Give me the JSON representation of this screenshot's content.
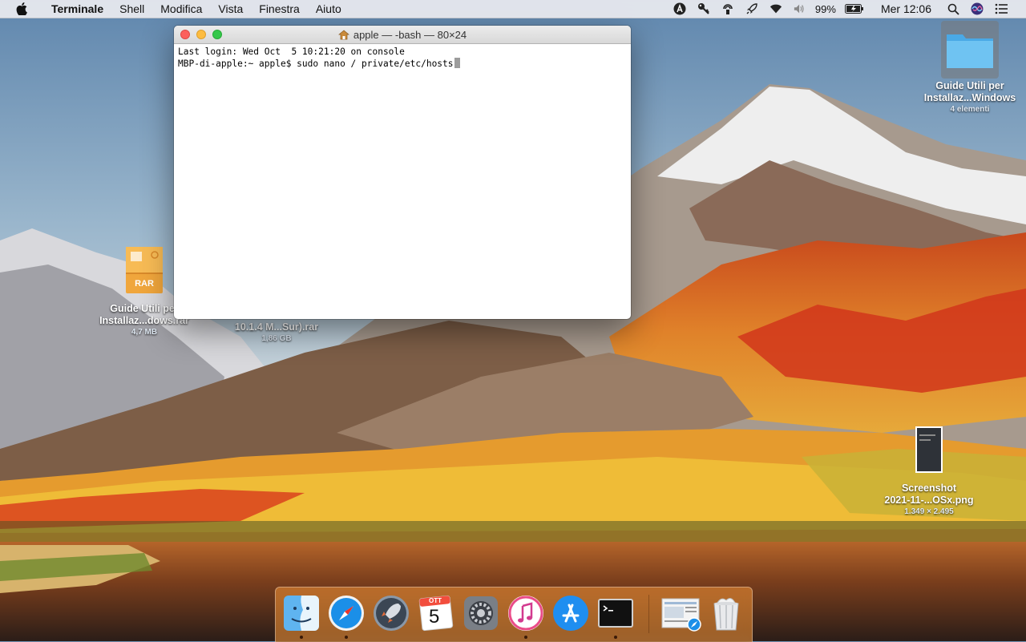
{
  "menubar": {
    "app_name": "Terminale",
    "items": [
      "Shell",
      "Modifica",
      "Vista",
      "Finestra",
      "Aiuto"
    ],
    "battery": "99%",
    "clock": "Mer 12:06"
  },
  "terminal": {
    "title": "apple — -bash — 80×24",
    "lines": [
      "Last login: Wed Oct  5 10:21:20 on console",
      "MBP-di-apple:~ apple$ sudo nano / private/etc/hosts"
    ]
  },
  "desktop": {
    "folder": {
      "label1": "Guide Utili per",
      "label2": "Installaz...Windows",
      "sub": "4 elementi"
    },
    "rar1": {
      "badge": "RAR",
      "label1": "Guide Utili per",
      "label2": "Installaz...dows.rar",
      "sub": "4,7 MB"
    },
    "rar2": {
      "label": "10.1.4 M...Sur).rar",
      "sub": "1,86 GB"
    },
    "screenshot": {
      "label1": "Screenshot",
      "label2": "2021-11-...OSx.png",
      "sub": "1.349 × 2.495"
    }
  },
  "dock": {
    "items": [
      {
        "name": "finder",
        "running": true
      },
      {
        "name": "safari",
        "running": true
      },
      {
        "name": "launchpad",
        "running": false
      },
      {
        "name": "calendar",
        "running": false,
        "month": "OTT",
        "day": "5"
      },
      {
        "name": "system-preferences",
        "running": false
      },
      {
        "name": "itunes",
        "running": true
      },
      {
        "name": "app-store",
        "running": false
      },
      {
        "name": "terminal",
        "running": true
      },
      {
        "name": "downloads-stack",
        "running": false
      },
      {
        "name": "trash",
        "running": false
      }
    ]
  },
  "colors": {
    "close": "#fc605c",
    "minimize": "#fdbc40",
    "zoom": "#34c84a",
    "dock_tint": "#f59637"
  }
}
